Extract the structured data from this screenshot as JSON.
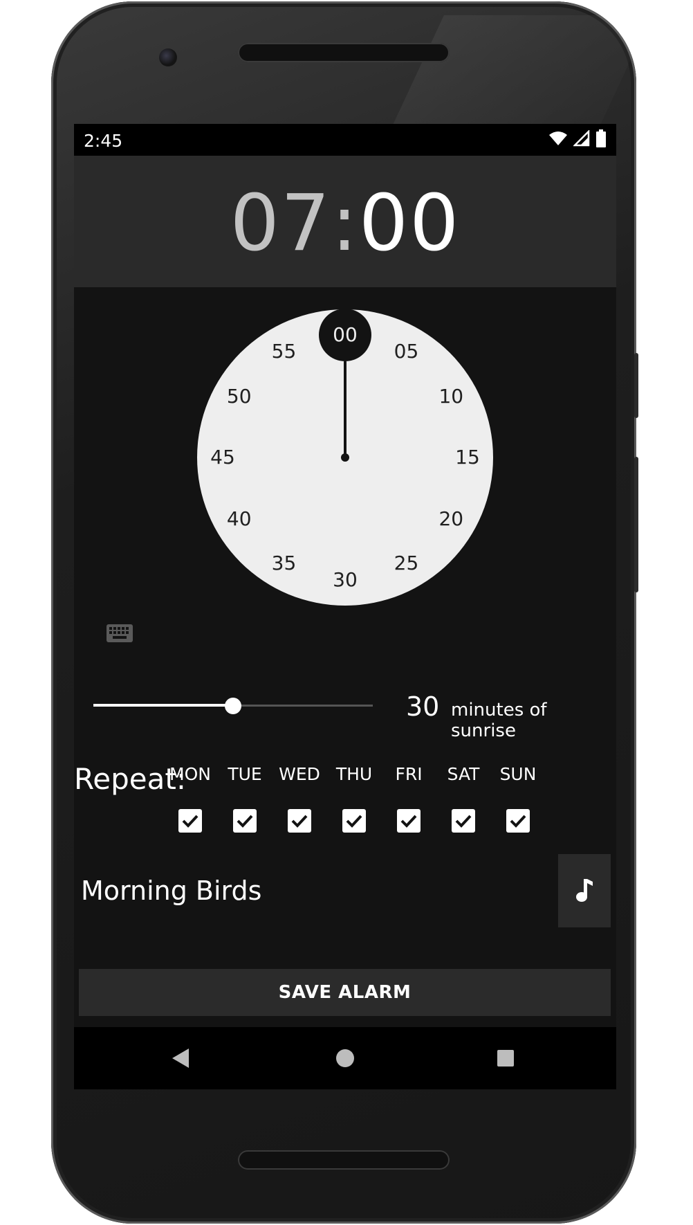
{
  "status_bar": {
    "time": "2:45",
    "icons": [
      "wifi-icon",
      "cellular-signal-icon",
      "battery-icon"
    ]
  },
  "alarm": {
    "hour": "07",
    "separator": ":",
    "minute": "00"
  },
  "clock_dial": {
    "selected": "00",
    "numbers": [
      "00",
      "05",
      "10",
      "15",
      "20",
      "25",
      "30",
      "35",
      "40",
      "45",
      "50",
      "55"
    ]
  },
  "sunrise": {
    "value": "30",
    "label": "minutes of sunrise",
    "fraction": 0.5
  },
  "repeat": {
    "label": "Repeat:",
    "days": [
      {
        "label": "MON",
        "checked": true
      },
      {
        "label": "TUE",
        "checked": true
      },
      {
        "label": "WED",
        "checked": true
      },
      {
        "label": "THU",
        "checked": true
      },
      {
        "label": "FRI",
        "checked": true
      },
      {
        "label": "SAT",
        "checked": true
      },
      {
        "label": "SUN",
        "checked": true
      }
    ]
  },
  "sound": {
    "name": "Morning Birds",
    "icon": "music-note-icon"
  },
  "save_label": "SAVE ALARM",
  "nav": {
    "icons": [
      "back-icon",
      "home-icon",
      "recents-icon"
    ]
  },
  "colors": {
    "screen_bg": "#131313",
    "header_bg": "#2a2a2a",
    "dial_bg": "#eeeeee",
    "accent": "#ffffff"
  }
}
